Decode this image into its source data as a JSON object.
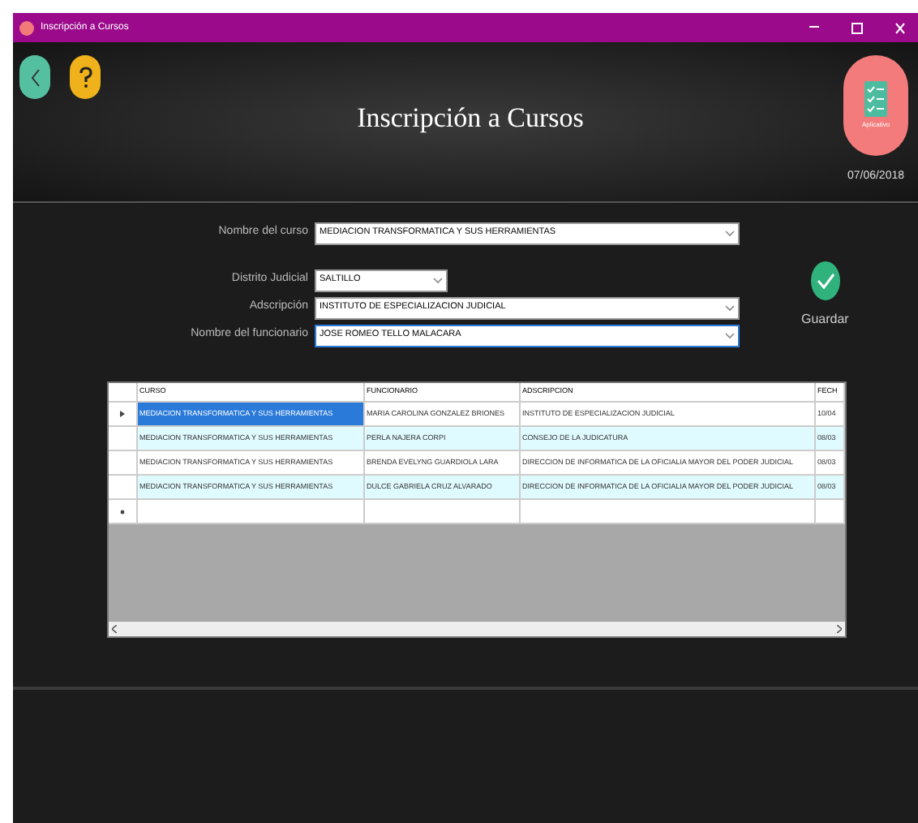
{
  "window": {
    "title": "Inscripción a Cursos"
  },
  "header": {
    "title": "Inscripción a Cursos",
    "logo_caption": "Aplicativo",
    "date": "07/06/2018"
  },
  "form": {
    "fields": [
      {
        "label": "Nombre del curso",
        "value": "MEDIACION TRANSFORMATICA Y SUS HERRAMIENTAS",
        "kind": "wide",
        "focused": false
      },
      {
        "label": "Distrito Judicial",
        "value": "SALTILLO",
        "kind": "short",
        "focused": false
      },
      {
        "label": "Adscripción",
        "value": "INSTITUTO DE ESPECIALIZACION JUDICIAL",
        "kind": "wide",
        "focused": false
      },
      {
        "label": "Nombre del funcionario",
        "value": "JOSE ROMEO TELLO MALACARA",
        "kind": "wide",
        "focused": true
      }
    ],
    "save_label": "Guardar"
  },
  "table": {
    "columns": [
      "CURSO",
      "FUNCIONARIO",
      "ADSCRIPCION",
      "FECH"
    ],
    "rows": [
      {
        "cells": [
          "MEDIACION TRANSFORMATICA Y SUS HERRAMIENTAS",
          "MARIA CAROLINA GONZALEZ BRIONES",
          "INSTITUTO DE ESPECIALIZACION JUDICIAL",
          "10/04"
        ],
        "selected": true
      },
      {
        "cells": [
          "MEDIACION TRANSFORMATICA Y SUS HERRAMIENTAS",
          "PERLA NAJERA CORPI",
          "CONSEJO DE LA JUDICATURA",
          "08/03"
        ],
        "selected": false
      },
      {
        "cells": [
          "MEDIACION TRANSFORMATICA Y SUS HERRAMIENTAS",
          "BRENDA EVELYNG GUARDIOLA LARA",
          "DIRECCION DE INFORMATICA DE LA OFICIALIA MAYOR DEL PODER JUDICIAL",
          "08/03"
        ],
        "selected": false
      },
      {
        "cells": [
          "MEDIACION TRANSFORMATICA Y SUS HERRAMIENTAS",
          "DULCE GABRIELA CRUZ ALVARADO",
          "DIRECCION DE INFORMATICA DE LA OFICIALIA MAYOR DEL PODER JUDICIAL",
          "08/03"
        ],
        "selected": false
      }
    ]
  }
}
